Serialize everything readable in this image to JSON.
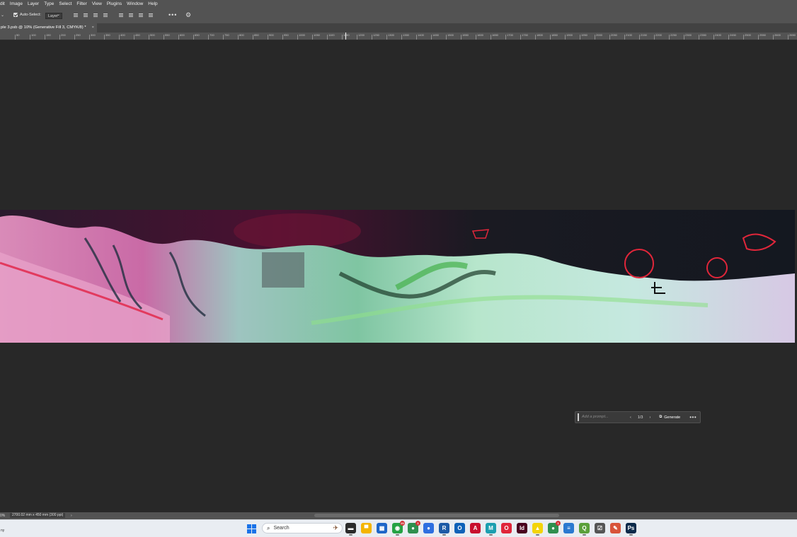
{
  "menubar": {
    "items": [
      "dit",
      "Image",
      "Layer",
      "Type",
      "Select",
      "Filter",
      "View",
      "Plugins",
      "Window",
      "Help"
    ]
  },
  "options_bar": {
    "auto_select_label": "Auto-Select:",
    "auto_select_checked": true,
    "auto_select_target": "Layer",
    "more_label": "•••"
  },
  "document_tab": {
    "title": "ple 3.psb @ 10% (Generative Fill 3, CMYK/8) *",
    "close_label": "×"
  },
  "ruler": {
    "labels": [
      "50",
      "100",
      "150",
      "200",
      "250",
      "300",
      "350",
      "400",
      "450",
      "500",
      "550",
      "600",
      "650",
      "700",
      "750",
      "800",
      "850",
      "900",
      "950",
      "1000",
      "1050",
      "1100",
      "1150",
      "1200",
      "1250",
      "1300",
      "1350",
      "1400",
      "1450",
      "1500",
      "1550",
      "1600",
      "1650",
      "1700",
      "1750",
      "1800",
      "1850",
      "1900",
      "1950",
      "2000",
      "2050",
      "2100",
      "2150",
      "2200",
      "2250",
      "2300",
      "2350",
      "2400",
      "2450",
      "2500",
      "2550",
      "2600",
      "2650"
    ]
  },
  "contextual_task_bar": {
    "prompt_placeholder": "Add a prompt...",
    "variation_counter": "1/3",
    "prev_label": "‹",
    "next_label": "›",
    "generate_label": "Generate",
    "more_label": "•••"
  },
  "status_bar": {
    "zoom": "0%",
    "doc_size": "2700.02 mm x 450 mm (300 ppi)",
    "arrow": "›"
  },
  "taskbar": {
    "left_text": "ny",
    "search_placeholder": "Search",
    "apps": [
      {
        "name": "file-explorer",
        "glyph": "▬",
        "color": "#2b2b2b"
      },
      {
        "name": "folder",
        "glyph": "▀",
        "color": "#f4b400"
      },
      {
        "name": "store",
        "glyph": "▦",
        "color": "#1e66c8"
      },
      {
        "name": "whatsapp",
        "glyph": "◉",
        "color": "#25a244",
        "badge": "20"
      },
      {
        "name": "chrome-profile-1",
        "glyph": "●",
        "color": "#2f8f4e",
        "badge": "1"
      },
      {
        "name": "messenger",
        "glyph": "●",
        "color": "#2e6fe0"
      },
      {
        "name": "revit",
        "glyph": "R",
        "color": "#1c5aa6"
      },
      {
        "name": "outlook",
        "glyph": "O",
        "color": "#0f62b8"
      },
      {
        "name": "acrobat",
        "glyph": "A",
        "color": "#c8102e"
      },
      {
        "name": "maps-app",
        "glyph": "M",
        "color": "#1c9fb0"
      },
      {
        "name": "opera",
        "glyph": "O",
        "color": "#e0263a"
      },
      {
        "name": "indesign",
        "glyph": "Id",
        "color": "#49021f"
      },
      {
        "name": "snapchat",
        "glyph": "▲",
        "color": "#f3d40a"
      },
      {
        "name": "chrome-profile-2",
        "glyph": "●",
        "color": "#2f8f4e",
        "badge": "1"
      },
      {
        "name": "notepad",
        "glyph": "≡",
        "color": "#2b79d0"
      },
      {
        "name": "qgis",
        "glyph": "Q",
        "color": "#5aa03a"
      },
      {
        "name": "task-app",
        "glyph": "☑",
        "color": "#555555"
      },
      {
        "name": "paint",
        "glyph": "✎",
        "color": "#d8543a"
      },
      {
        "name": "photoshop",
        "glyph": "Ps",
        "color": "#0b2a4a"
      }
    ]
  }
}
